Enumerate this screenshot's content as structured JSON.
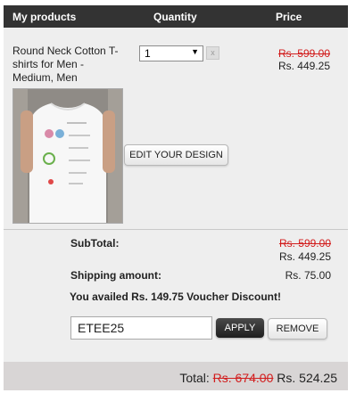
{
  "header": {
    "col_products": "My products",
    "col_quantity": "Quantity",
    "col_price": "Price"
  },
  "product": {
    "name": "Round Neck Cotton T-shirts for Men - Medium, Men",
    "quantity": "1",
    "remove_glyph": "x",
    "old_price": "Rs. 599.00",
    "new_price": "Rs. 449.25",
    "edit_label": "EDIT YOUR DESIGN",
    "image_icon": "tshirt-image"
  },
  "summary": {
    "subtotal_label": "SubTotal:",
    "subtotal_old": "Rs. 599.00",
    "subtotal_new": "Rs. 449.25",
    "shipping_label": "Shipping amount:",
    "shipping_value": "Rs. 75.00",
    "voucher_message": "You availed Rs. 149.75 Voucher Discount!"
  },
  "coupon": {
    "code": "ETEE25",
    "apply_label": "APPLY",
    "remove_label": "REMOVE"
  },
  "total": {
    "label": "Total:",
    "old": "Rs. 674.00",
    "new": "Rs. 524.25"
  },
  "colors": {
    "header_bg": "#333333",
    "strike_red": "#d21d1d",
    "footer_bg": "#d8d5d5"
  }
}
